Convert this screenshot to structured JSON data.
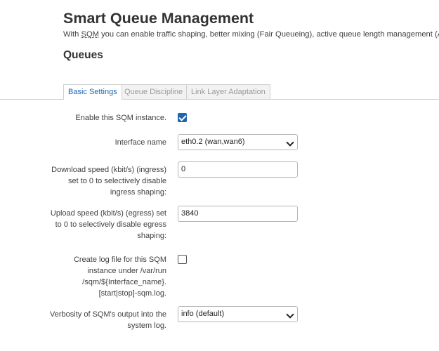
{
  "page": {
    "title": "Smart Queue Management",
    "intro_prefix": "With ",
    "intro_abbr": "SQM",
    "intro_rest": " you can enable traffic shaping, better mixing (Fair Queueing), active queue length management (AQM)",
    "section_title": "Queues"
  },
  "tabs": [
    {
      "label": "Basic Settings",
      "active": true
    },
    {
      "label": "Queue Discipline",
      "active": false
    },
    {
      "label": "Link Layer Adaptation",
      "active": false
    }
  ],
  "form": {
    "enable": {
      "label": "Enable this SQM instance.",
      "checked": true
    },
    "interface": {
      "label": "Interface name",
      "value": "eth0.2 (wan,wan6)"
    },
    "download": {
      "label": "Download speed (kbit/s) (ingress) set to 0 to selectively disable ingress shaping:",
      "value": "0"
    },
    "upload": {
      "label": "Upload speed (kbit/s) (egress) set to 0 to selectively disable egress shaping:",
      "value": "3840"
    },
    "logfile": {
      "label": "Create log file for this SQM instance under /var/run /sqm/${Interface_name}.[start|stop]-sqm.log.",
      "checked": false
    },
    "verbosity": {
      "label": "Verbosity of SQM's output into the system log.",
      "value": "info (default)"
    }
  },
  "icons": {
    "dropdown": "chevron-down-icon",
    "check": "checkmark-icon"
  },
  "colors": {
    "accent": "#1e65b0",
    "text": "#404040",
    "heading": "#333333",
    "tab_inactive": "#9a9a9a"
  }
}
